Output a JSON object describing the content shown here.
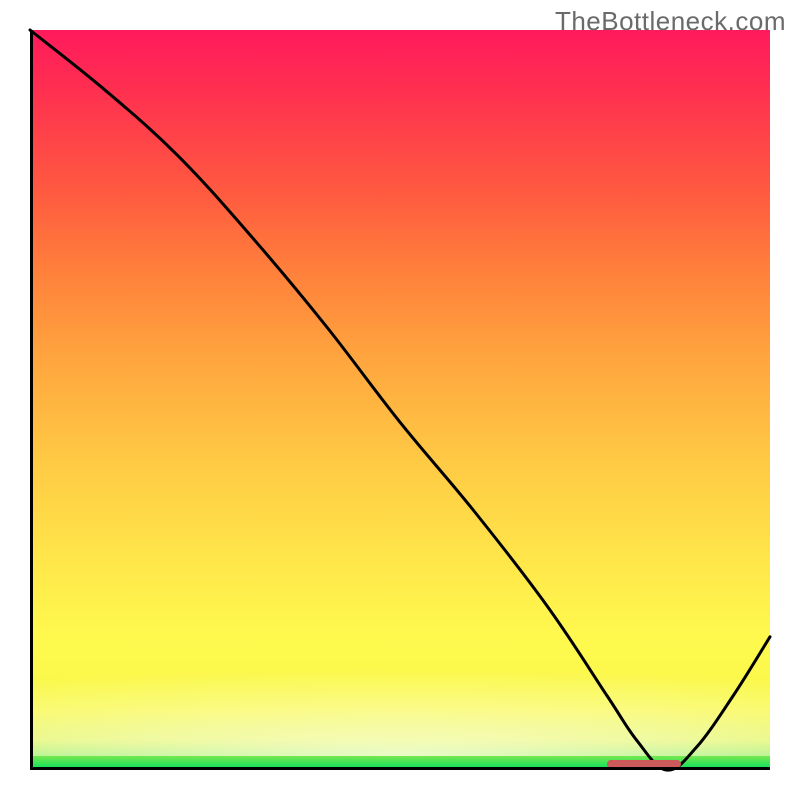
{
  "watermark": "TheBottleneck.com",
  "chart_data": {
    "type": "line",
    "title": "",
    "xlabel": "",
    "ylabel": "",
    "xlim": [
      0,
      100
    ],
    "ylim": [
      0,
      100
    ],
    "grid": false,
    "series": [
      {
        "name": "bottleneck-curve",
        "x": [
          0,
          10,
          20,
          30,
          40,
          50,
          60,
          70,
          78,
          82,
          86,
          90,
          95,
          100
        ],
        "values": [
          100,
          92,
          83,
          72,
          60,
          47,
          35,
          22,
          10,
          4,
          0,
          3,
          10,
          18
        ]
      }
    ],
    "annotations": [
      {
        "name": "optimal-range-marker",
        "x_start": 78,
        "x_end": 88,
        "y": 0
      }
    ],
    "background": {
      "type": "vertical-gradient",
      "stops": [
        {
          "pos": 0,
          "color": "#00e060"
        },
        {
          "pos": 4,
          "color": "#d9f24c"
        },
        {
          "pos": 18,
          "color": "#fff94e"
        },
        {
          "pos": 42,
          "color": "#ffc944"
        },
        {
          "pos": 68,
          "color": "#ff7e3b"
        },
        {
          "pos": 92,
          "color": "#ff2f50"
        },
        {
          "pos": 100,
          "color": "#ff1a5c"
        }
      ]
    }
  }
}
